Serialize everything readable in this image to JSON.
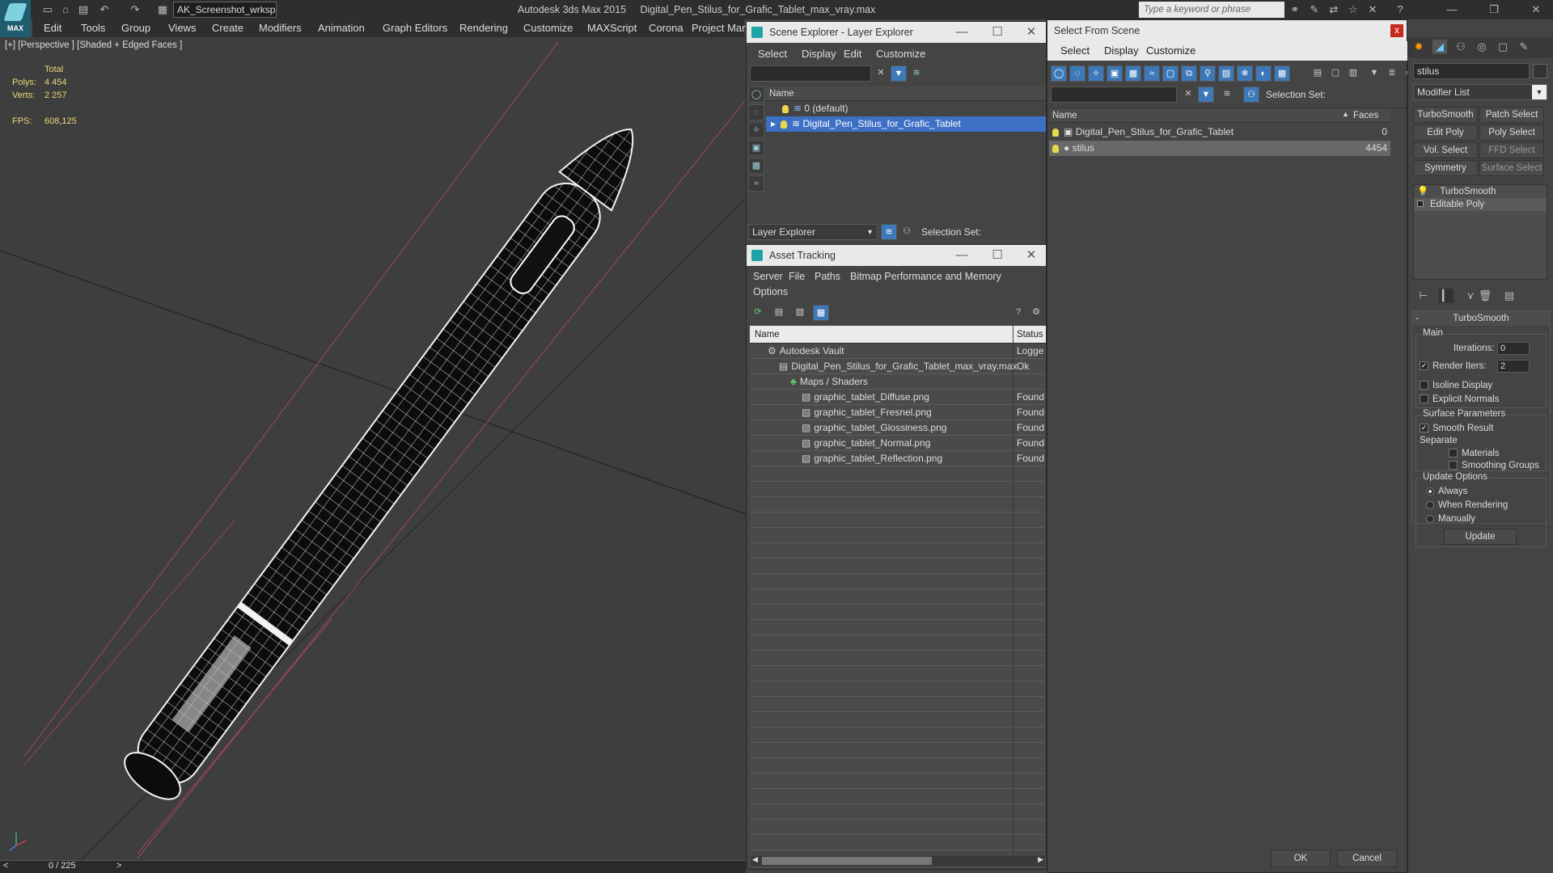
{
  "titlebar": {
    "workspace": "AK_Screenshot_wrksp",
    "app_name": "Autodesk 3ds Max  2015",
    "file_name": "Digital_Pen_Stilus_for_Grafic_Tablet_max_vray.max",
    "search_placeholder": "Type a keyword or phrase",
    "logo": "MAX"
  },
  "menubar": [
    "Edit",
    "Tools",
    "Group",
    "Views",
    "Create",
    "Modifiers",
    "Animation",
    "Graph Editors",
    "Rendering",
    "Customize",
    "MAXScript",
    "Corona",
    "Project Man"
  ],
  "viewport": {
    "label": "[+] [Perspective ] [Shaded + Edged Faces ]",
    "stats": {
      "total": "Total",
      "polys_label": "Polys:",
      "polys": "4 454",
      "verts_label": "Verts:",
      "verts": "2 257",
      "fps_label": "FPS:",
      "fps": "608,125"
    }
  },
  "timeline": {
    "frame": "0 / 225"
  },
  "scene_explorer": {
    "title": "Scene Explorer - Layer Explorer",
    "menu": [
      "Select",
      "Display",
      "Edit",
      "Customize"
    ],
    "col_name": "Name",
    "layers": [
      "0 (default)",
      "Digital_Pen_Stilus_for_Grafic_Tablet"
    ],
    "footer_dropdown": "Layer Explorer",
    "selection_set_label": "Selection Set:"
  },
  "asset_tracking": {
    "title": "Asset Tracking",
    "menu": [
      "Server",
      "File",
      "Paths",
      "Bitmap Performance and Memory",
      "Options"
    ],
    "col_name": "Name",
    "col_status": "Status",
    "rows": [
      {
        "name": "Autodesk Vault",
        "status": "Logge",
        "indent": 0
      },
      {
        "name": "Digital_Pen_Stilus_for_Grafic_Tablet_max_vray.max",
        "status": "Ok",
        "indent": 1
      },
      {
        "name": "Maps / Shaders",
        "status": "",
        "indent": 2
      },
      {
        "name": "graphic_tablet_Diffuse.png",
        "status": "Found",
        "indent": 3
      },
      {
        "name": "graphic_tablet_Fresnel.png",
        "status": "Found",
        "indent": 3
      },
      {
        "name": "graphic_tablet_Glossiness.png",
        "status": "Found",
        "indent": 3
      },
      {
        "name": "graphic_tablet_Normal.png",
        "status": "Found",
        "indent": 3
      },
      {
        "name": "graphic_tablet_Reflection.png",
        "status": "Found",
        "indent": 3
      }
    ]
  },
  "select_from_scene": {
    "title": "Select From Scene",
    "close": "x",
    "menu": [
      "Select",
      "Display",
      "Customize"
    ],
    "selection_set_label": "Selection Set:",
    "col_name": "Name",
    "col_faces": "Faces",
    "rows": [
      {
        "name": "Digital_Pen_Stilus_for_Grafic_Tablet",
        "faces": "0"
      },
      {
        "name": "stilus",
        "faces": "4454"
      }
    ],
    "ok": "OK",
    "cancel": "Cancel"
  },
  "command_panel": {
    "object_name": "stilus",
    "modifier_list": "Modifier List",
    "modifier_buttons": [
      "TurboSmooth",
      "Patch Select",
      "Edit Poly",
      "Poly Select",
      "Vol. Select",
      "FFD Select",
      "Symmetry",
      "Surface Select"
    ],
    "stack": [
      "TurboSmooth",
      "Editable Poly"
    ],
    "rollout_title": "TurboSmooth",
    "main_label": "Main",
    "iterations_label": "Iterations:",
    "iterations": "0",
    "render_iters_label": "Render Iters:",
    "render_iters": "2",
    "isoline_display": "Isoline Display",
    "explicit_normals": "Explicit Normals",
    "surface_params": "Surface Parameters",
    "smooth_result": "Smooth Result",
    "separate": "Separate",
    "materials": "Materials",
    "smoothing_groups": "Smoothing Groups",
    "update_options": "Update Options",
    "always": "Always",
    "when_rendering": "When Rendering",
    "manually": "Manually",
    "update": "Update"
  }
}
